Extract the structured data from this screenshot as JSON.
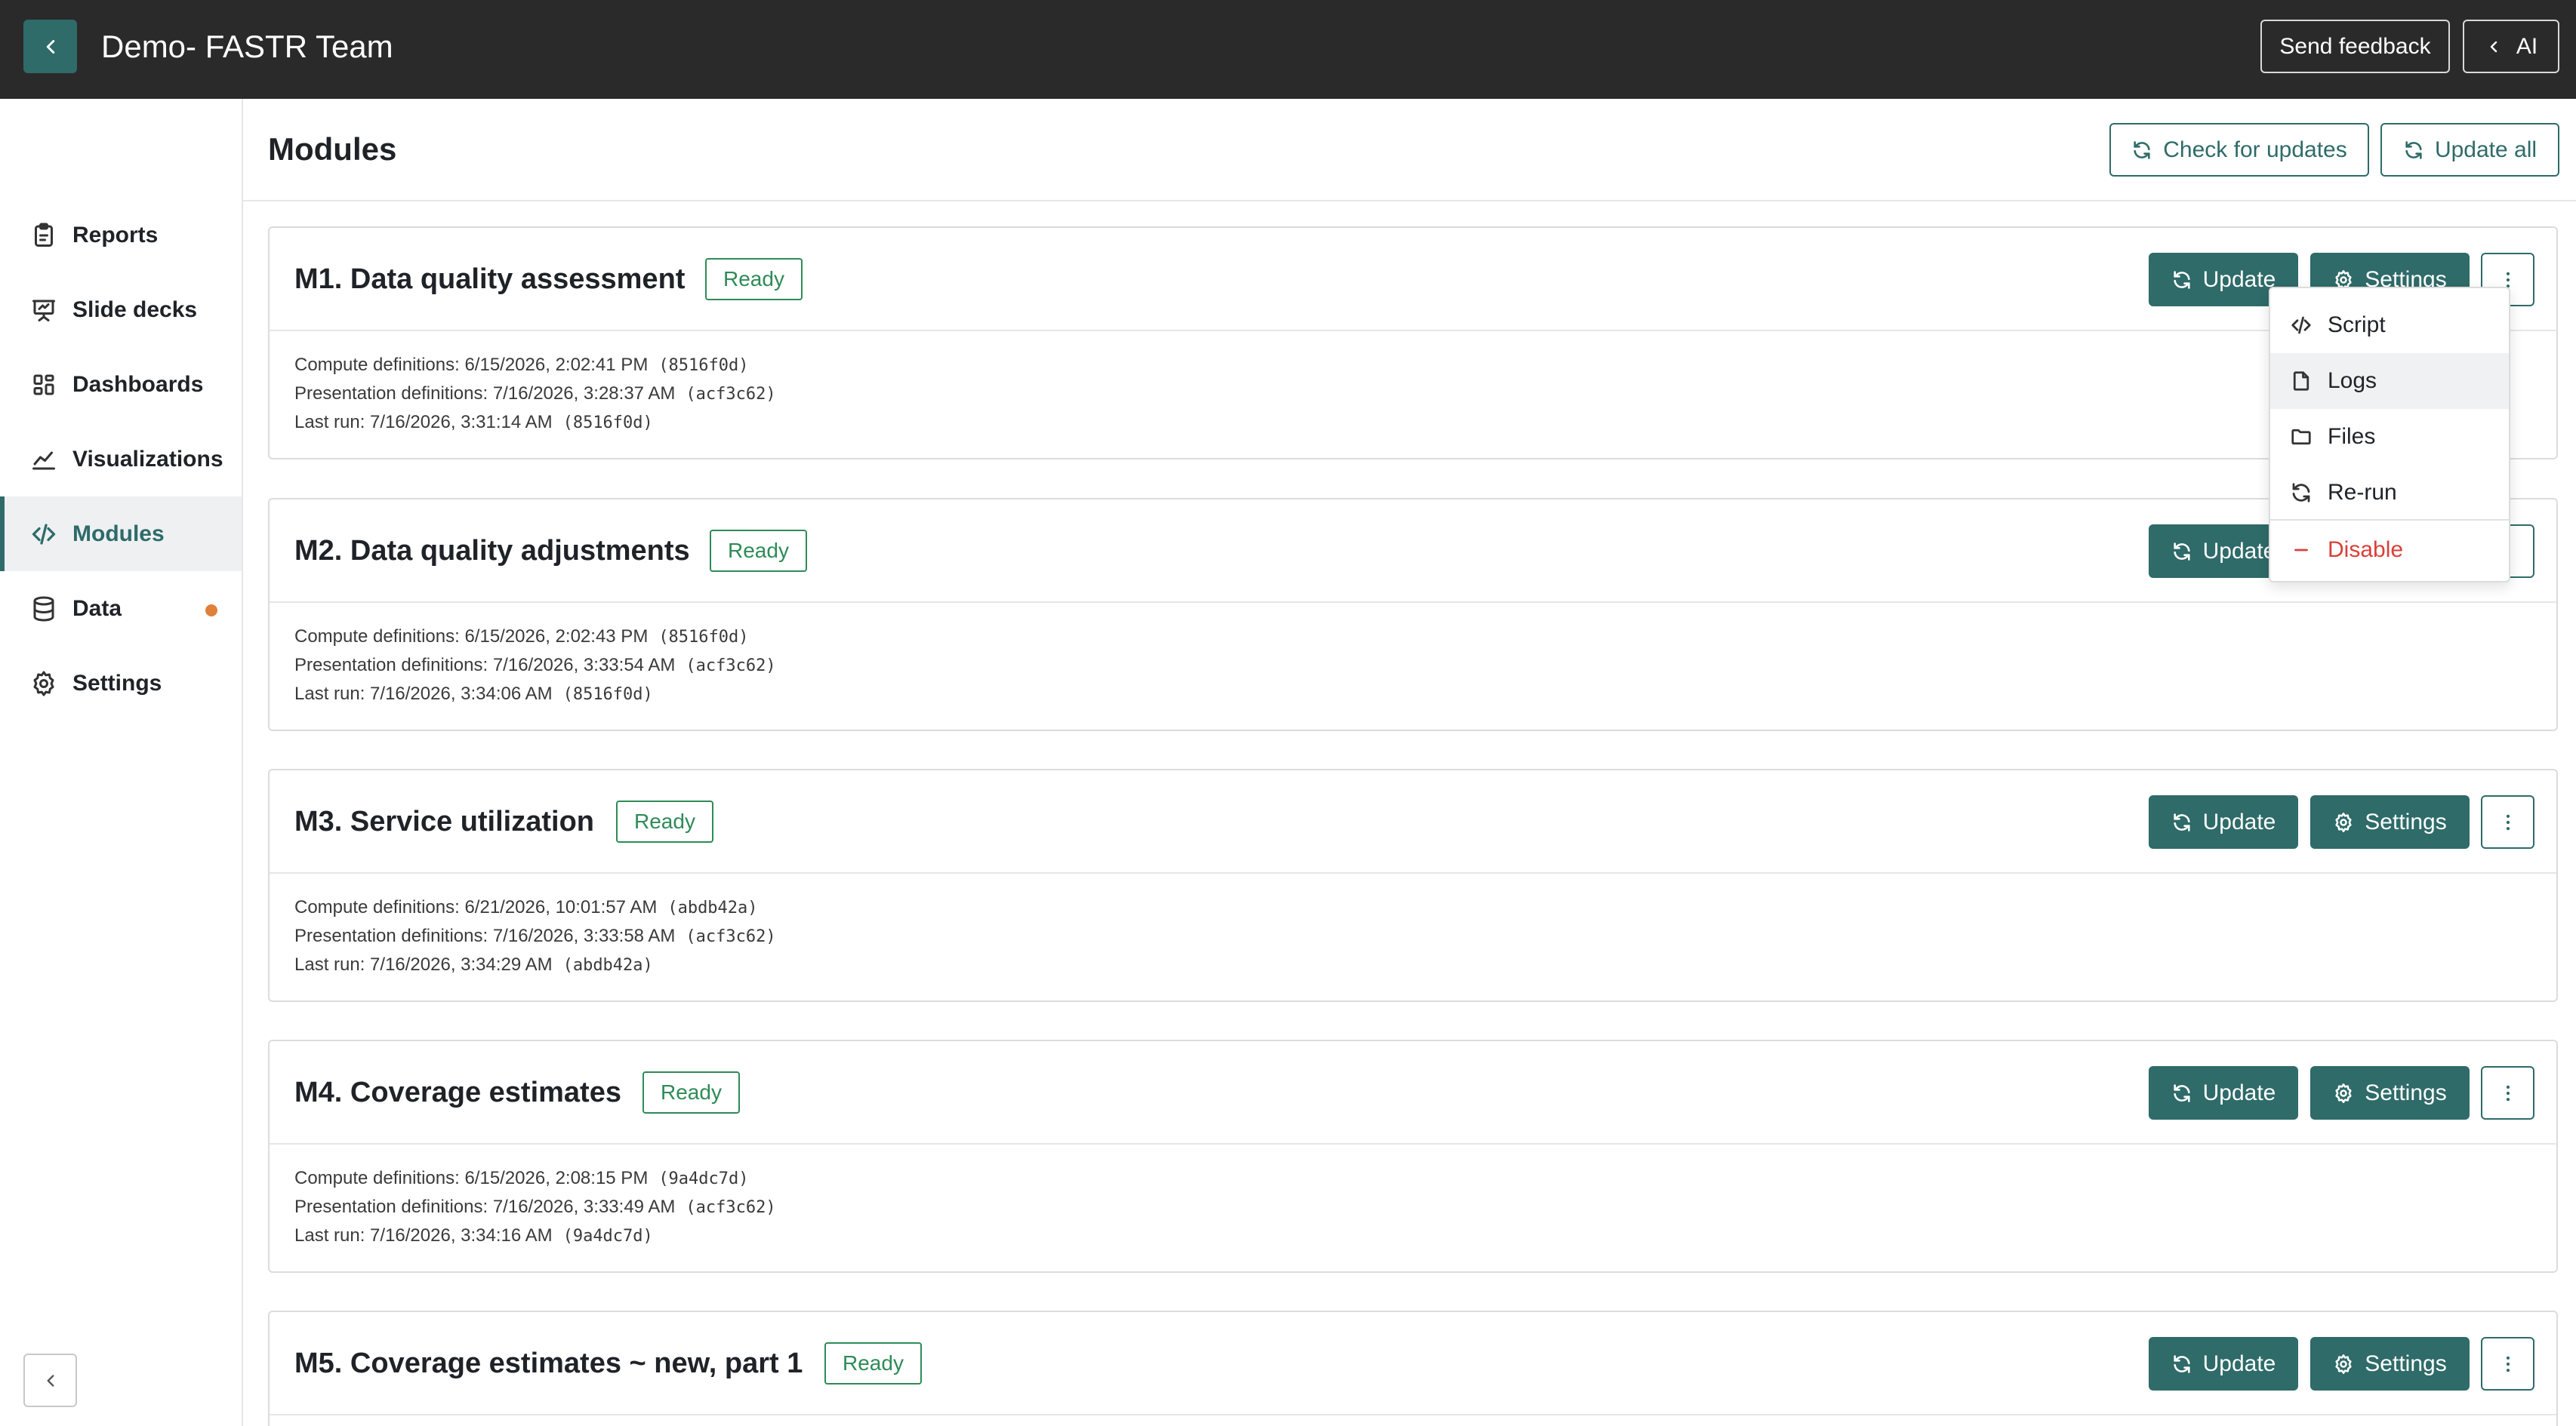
{
  "header": {
    "title": "Demo- FASTR Team",
    "send_feedback": "Send feedback",
    "ai_label": "AI"
  },
  "sidebar": {
    "items": [
      {
        "label": "Reports",
        "icon": "clipboard-icon"
      },
      {
        "label": "Slide decks",
        "icon": "presentation-icon"
      },
      {
        "label": "Dashboards",
        "icon": "grid-icon"
      },
      {
        "label": "Visualizations",
        "icon": "chart-line-icon"
      },
      {
        "label": "Modules",
        "icon": "code-icon",
        "active": true
      },
      {
        "label": "Data",
        "icon": "database-icon",
        "indicator": true
      },
      {
        "label": "Settings",
        "icon": "gear-icon"
      }
    ]
  },
  "main": {
    "title": "Modules",
    "check_updates": "Check for updates",
    "update_all": "Update all"
  },
  "labels": {
    "update": "Update",
    "settings": "Settings"
  },
  "modules": [
    {
      "title": "M1. Data quality assessment",
      "status": "Ready",
      "compute": "Compute definitions: 6/15/2026, 2:02:41 PM",
      "compute_hash": "(8516f0d)",
      "presentation": "Presentation definitions: 7/16/2026, 3:28:37 AM",
      "presentation_hash": "(acf3c62)",
      "last_run": "Last run: 7/16/2026, 3:31:14 AM",
      "last_run_hash": "(8516f0d)"
    },
    {
      "title": "M2. Data quality adjustments",
      "status": "Ready",
      "compute": "Compute definitions: 6/15/2026, 2:02:43 PM",
      "compute_hash": "(8516f0d)",
      "presentation": "Presentation definitions: 7/16/2026, 3:33:54 AM",
      "presentation_hash": "(acf3c62)",
      "last_run": "Last run: 7/16/2026, 3:34:06 AM",
      "last_run_hash": "(8516f0d)"
    },
    {
      "title": "M3. Service utilization",
      "status": "Ready",
      "compute": "Compute definitions: 6/21/2026, 10:01:57 AM",
      "compute_hash": "(abdb42a)",
      "presentation": "Presentation definitions: 7/16/2026, 3:33:58 AM",
      "presentation_hash": "(acf3c62)",
      "last_run": "Last run: 7/16/2026, 3:34:29 AM",
      "last_run_hash": "(abdb42a)"
    },
    {
      "title": "M4. Coverage estimates",
      "status": "Ready",
      "compute": "Compute definitions: 6/15/2026, 2:08:15 PM",
      "compute_hash": "(9a4dc7d)",
      "presentation": "Presentation definitions: 7/16/2026, 3:33:49 AM",
      "presentation_hash": "(acf3c62)",
      "last_run": "Last run: 7/16/2026, 3:34:16 AM",
      "last_run_hash": "(9a4dc7d)"
    },
    {
      "title": "M5. Coverage estimates ~ new, part 1",
      "status": "Ready"
    }
  ],
  "menu": {
    "items": [
      {
        "label": "Script",
        "icon": "code-icon"
      },
      {
        "label": "Logs",
        "icon": "file-icon"
      },
      {
        "label": "Files",
        "icon": "folder-icon"
      },
      {
        "label": "Re-run",
        "icon": "refresh-icon"
      },
      {
        "label": "Disable",
        "icon": "minus-icon"
      }
    ]
  },
  "colors": {
    "accent": "#2e6b69",
    "topbar": "#2a2a2a",
    "ready": "#2e8b57",
    "danger": "#d9403a",
    "indicator": "#e0803a"
  }
}
